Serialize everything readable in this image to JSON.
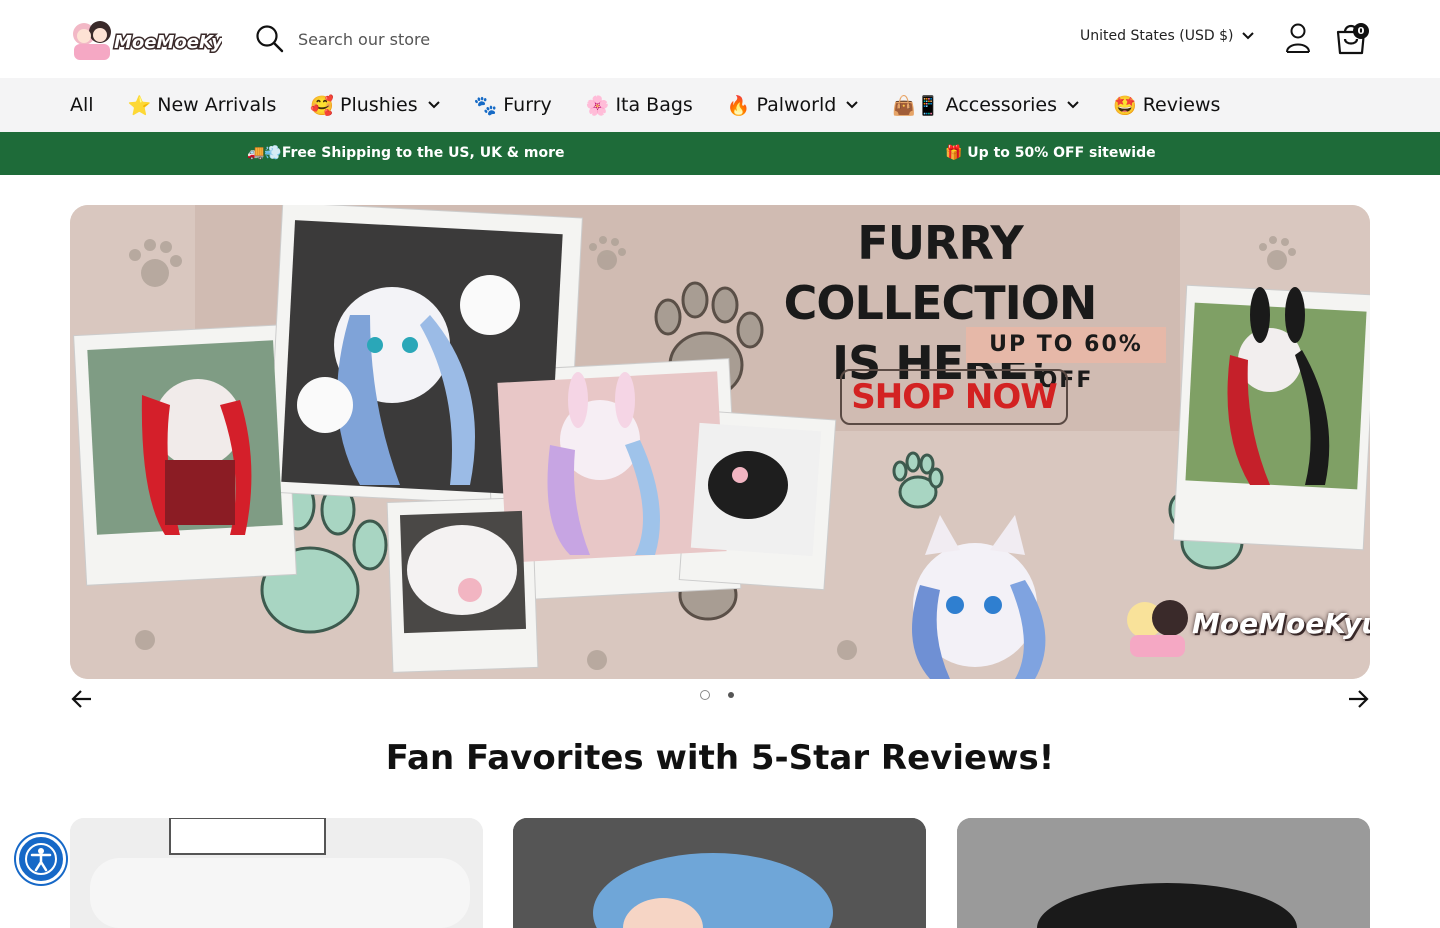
{
  "header": {
    "logo_text": "MoeMoeKyun!",
    "search": {
      "placeholder": "Search our store"
    },
    "country_selector": "United States (USD $)",
    "cart_count": "0"
  },
  "nav": {
    "items": [
      {
        "emoji": "",
        "label": "All",
        "has_dropdown": false
      },
      {
        "emoji": "⭐",
        "label": "New Arrivals",
        "has_dropdown": false
      },
      {
        "emoji": "🥰",
        "label": "Plushies",
        "has_dropdown": true
      },
      {
        "emoji": "🐾",
        "label": "Furry",
        "has_dropdown": false
      },
      {
        "emoji": "🌸",
        "label": "Ita Bags",
        "has_dropdown": false
      },
      {
        "emoji": "🔥",
        "label": "Palworld",
        "has_dropdown": true
      },
      {
        "emoji": "👜📱",
        "label": "Accessories",
        "has_dropdown": true
      },
      {
        "emoji": "🤩",
        "label": "Reviews",
        "has_dropdown": false
      }
    ]
  },
  "promo": {
    "left": "🚚💨Free Shipping to the US, UK & more",
    "right": "🎁 Up to 50% OFF sitewide"
  },
  "banner": {
    "title_line1": "FURRY COLLECTION",
    "title_line2": "IS HERE!",
    "discount": "UP TO 60% OFF",
    "cta": "SHOP NOW",
    "brand": "MoeMoeKyun!",
    "slides": 2,
    "active_slide": 1
  },
  "section": {
    "title": "Fan Favorites with 5-Star Reviews!"
  },
  "colors": {
    "promo_bg": "#1e6b39",
    "nav_bg": "#f4f4f5",
    "banner_bg": "#d9c7bf",
    "cta_text": "#d32222",
    "a11y_blue": "#1668c7"
  }
}
